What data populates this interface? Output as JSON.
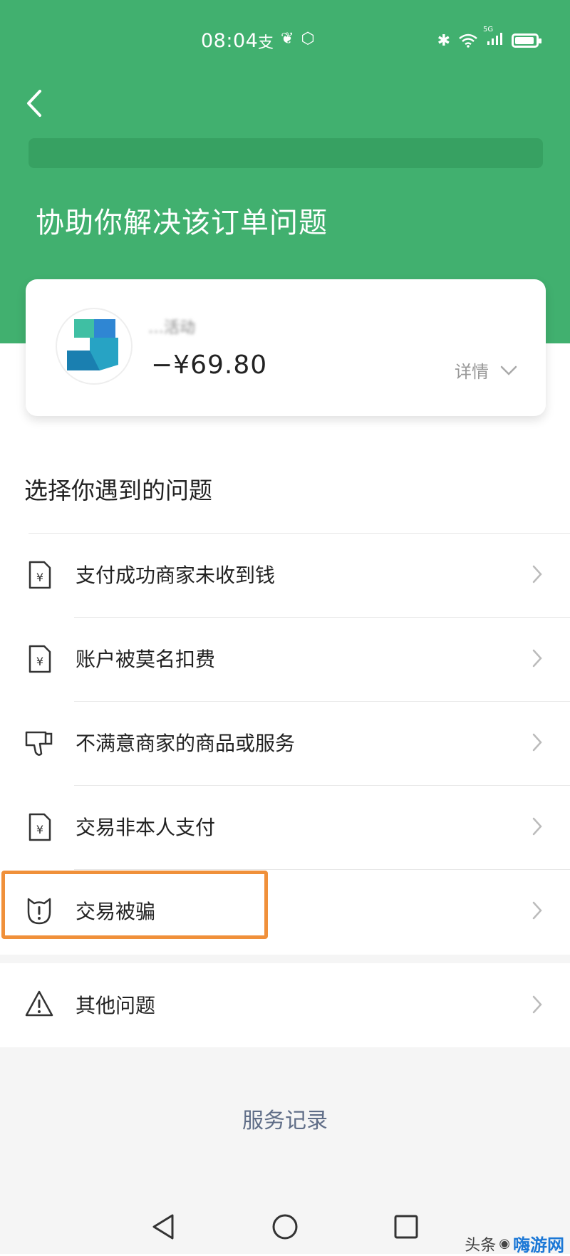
{
  "colors": {
    "accent": "#41b06f",
    "highlight": "#f0903a",
    "link": "#5f6d87"
  },
  "status_bar": {
    "time": "08:04",
    "network": "5G"
  },
  "header": {
    "title": "协助你解决该订单问题"
  },
  "order": {
    "merchant": "…活动",
    "amount": "−¥69.80",
    "details_label": "详情"
  },
  "issues": {
    "title": "选择你遇到的问题",
    "items": [
      {
        "label": "支付成功商家未收到钱",
        "icon": "receipt-icon"
      },
      {
        "label": "账户被莫名扣费",
        "icon": "receipt-icon"
      },
      {
        "label": "不满意商家的商品或服务",
        "icon": "thumbs-down-icon"
      },
      {
        "label": "交易非本人支付",
        "icon": "receipt-icon"
      },
      {
        "label": "交易被骗",
        "icon": "alert-shield-icon",
        "highlighted": true
      }
    ],
    "other": {
      "label": "其他问题",
      "icon": "warning-icon"
    }
  },
  "footer": {
    "service_record": "服务记录"
  },
  "watermark": {
    "source": "头条",
    "brand": "嗨游网"
  }
}
